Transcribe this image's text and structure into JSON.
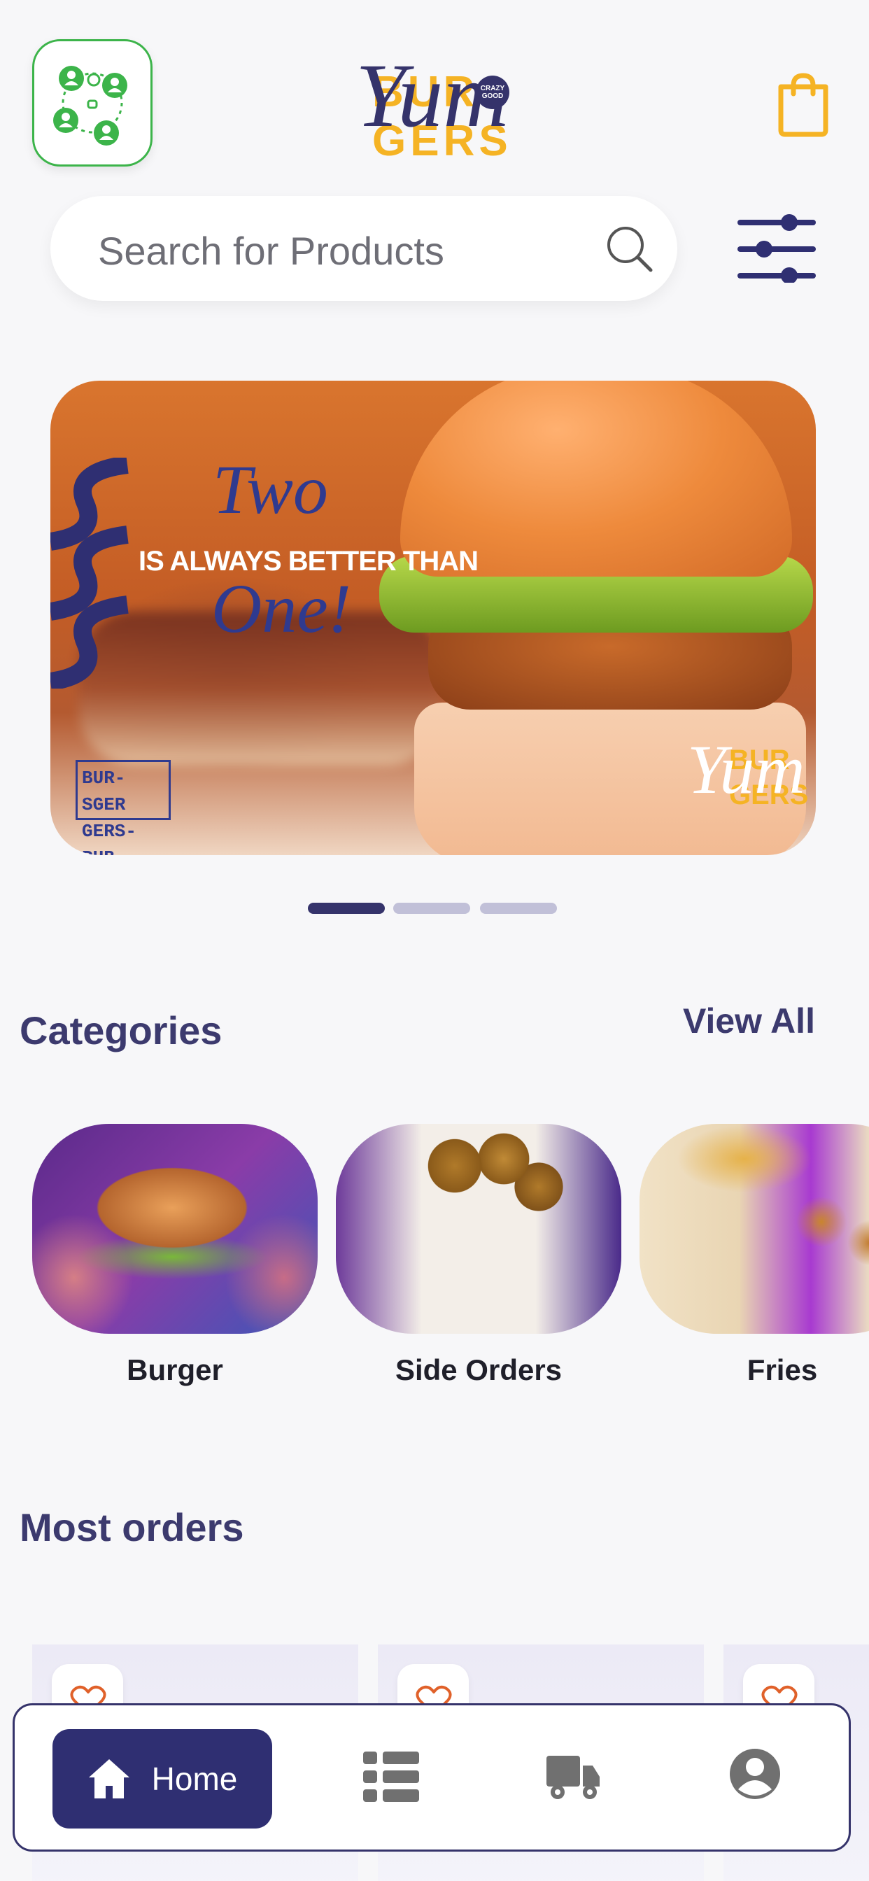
{
  "header": {
    "logo": {
      "bur": "BUR",
      "gers": "GERS",
      "yum": "Yum",
      "badge": "CRAZY GOOD"
    },
    "icons": {
      "group": "group-share-icon",
      "cart": "shopping-bag-icon"
    }
  },
  "search": {
    "placeholder": "Search for Products",
    "icon": "search-icon"
  },
  "filter": {
    "icon": "sliders-icon"
  },
  "banner": {
    "line1": "Two",
    "line2": "IS ALWAYS BETTER THAN",
    "line3": "One!",
    "stamp_top": "BUR-SGER",
    "stamp_bottom": "GERS-RUB",
    "mini_logo": {
      "yum": "Yum",
      "bur": "BUR",
      "gers": "GERS"
    },
    "active_slide": 1,
    "slide_count": 3
  },
  "categories": {
    "title": "Categories",
    "view_all": "View All",
    "items": [
      {
        "label": "Burger"
      },
      {
        "label": "Side Orders"
      },
      {
        "label": "Fries"
      }
    ]
  },
  "most_orders": {
    "title": "Most orders",
    "cards": [
      {
        "favorite": false
      },
      {
        "favorite": false
      },
      {
        "favorite": false
      }
    ]
  },
  "bottom_nav": {
    "items": [
      {
        "label": "Home",
        "icon": "home-icon",
        "active": true
      },
      {
        "label": "",
        "icon": "list-icon",
        "active": false
      },
      {
        "label": "",
        "icon": "delivery-truck-icon",
        "active": false
      },
      {
        "label": "",
        "icon": "account-icon",
        "active": false
      }
    ]
  },
  "colors": {
    "brand_navy": "#35336b",
    "brand_yellow": "#f5b324",
    "accent_green": "#3cb44a",
    "nav_active_bg": "#2f2f72",
    "heart": "#e0612a"
  }
}
